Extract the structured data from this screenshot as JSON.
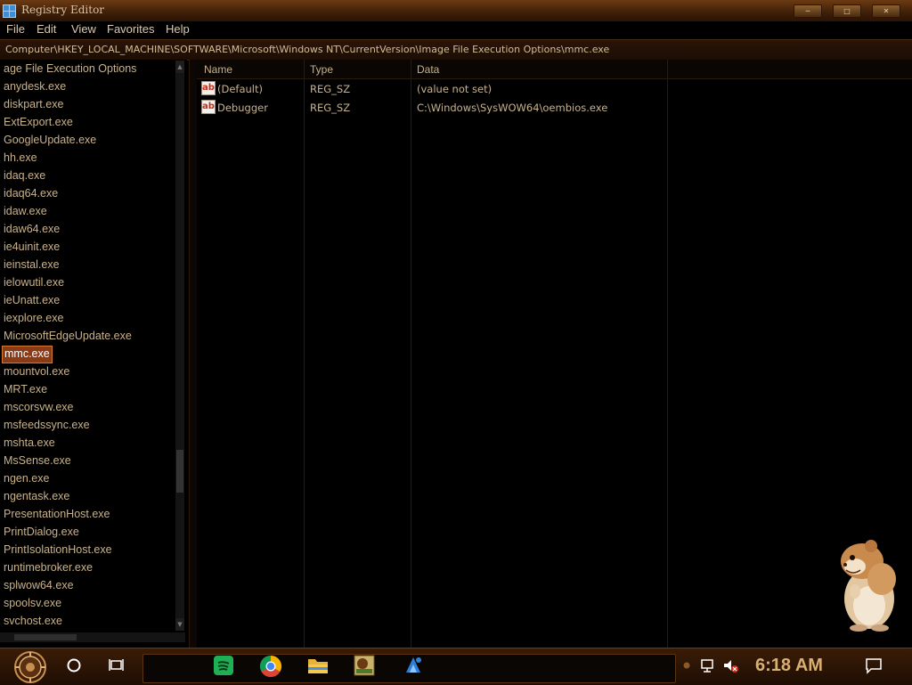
{
  "window": {
    "title": "Registry Editor",
    "controls": [
      "minimize",
      "maximize",
      "close"
    ]
  },
  "menu": {
    "items": [
      "File",
      "Edit",
      "View",
      "Favorites",
      "Help"
    ]
  },
  "address": {
    "path": "Computer\\HKEY_LOCAL_MACHINE\\SOFTWARE\\Microsoft\\Windows NT\\CurrentVersion\\Image File Execution Options\\mmc.exe"
  },
  "tree": {
    "items": [
      "age File Execution Options",
      "anydesk.exe",
      "diskpart.exe",
      "ExtExport.exe",
      "GoogleUpdate.exe",
      "hh.exe",
      "idaq.exe",
      "idaq64.exe",
      "idaw.exe",
      "idaw64.exe",
      "ie4uinit.exe",
      "ieinstal.exe",
      "ielowutil.exe",
      "ieUnatt.exe",
      "iexplore.exe",
      "MicrosoftEdgeUpdate.exe",
      "mmc.exe",
      "mountvol.exe",
      "MRT.exe",
      "mscorsvw.exe",
      "msfeedssync.exe",
      "mshta.exe",
      "MsSense.exe",
      "ngen.exe",
      "ngentask.exe",
      "PresentationHost.exe",
      "PrintDialog.exe",
      "PrintIsolationHost.exe",
      "runtimebroker.exe",
      "splwow64.exe",
      "spoolsv.exe",
      "svchost.exe"
    ],
    "selected": "mmc.exe"
  },
  "list": {
    "columns": [
      "Name",
      "Type",
      "Data"
    ],
    "rows": [
      {
        "name": "(Default)",
        "type": "REG_SZ",
        "data": "(value not set)",
        "icon": "string-value-icon"
      },
      {
        "name": "Debugger",
        "type": "REG_SZ",
        "data": "C:\\Windows\\SysWOW64\\oembios.exe",
        "icon": "string-value-icon"
      }
    ]
  },
  "taskbar": {
    "pinned": [
      "start-orb-icon",
      "cortana-circle-icon",
      "task-view-icon",
      "spotify-icon",
      "chrome-icon",
      "file-explorer-icon",
      "game-icon",
      "app-blue-icon"
    ],
    "clock": "6:18 AM"
  },
  "theme": {
    "accent": "#d8b072",
    "text": "#c8b28c",
    "selection": "#8a3a14"
  }
}
